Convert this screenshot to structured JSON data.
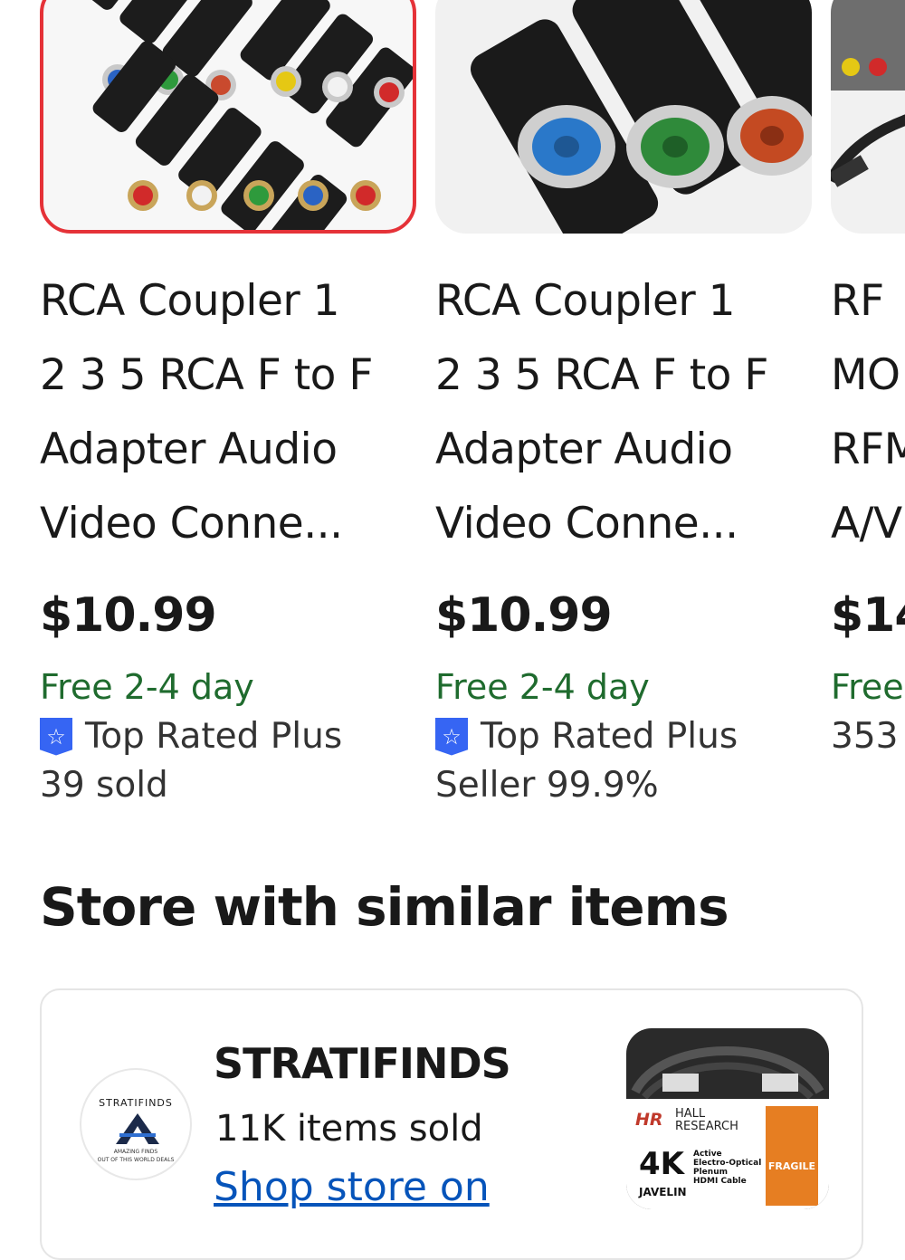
{
  "listings": [
    {
      "title": "RCA Coupler 1\n2 3 5 RCA F to F\nAdapter Audio\nVideo Conne...",
      "price": "$10.99",
      "shipping": "Free 2-4 day",
      "badge": "Top Rated Plus",
      "meta": "39 sold",
      "selected": true
    },
    {
      "title": "RCA Coupler 1\n2 3 5 RCA F to F\nAdapter Audio\nVideo Conne...",
      "price": "$10.99",
      "shipping": "Free 2-4 day",
      "badge": "Top Rated Plus",
      "meta": "Seller 99.9%",
      "selected": false
    },
    {
      "title": "RF\nMO\nRFM\nA/V",
      "price": "$14",
      "shipping": "Free",
      "badge": "",
      "meta": "353",
      "selected": false
    }
  ],
  "section": {
    "title": "Store with similar items"
  },
  "store": {
    "name": "STRATIFINDS",
    "sold": "11K items sold",
    "link": "Shop store on",
    "logo_text": "STRATIFINDS",
    "logo_tagline": "AMAZING FINDS\nOUT OF THIS WORLD DEALS",
    "thumb": {
      "brand_hr": "HR",
      "brand": "HALL\nRESEARCH",
      "resolution": "4K",
      "product": "Active\nElectro-Optical\nPlenum\nHDMI Cable",
      "series": "JAVELIN",
      "fragile": "FRAGILE"
    }
  },
  "colors": {
    "shipping": "#1f6b2e",
    "badge": "#3665f3",
    "selected_border": "#e53238",
    "link": "#0654ba"
  }
}
